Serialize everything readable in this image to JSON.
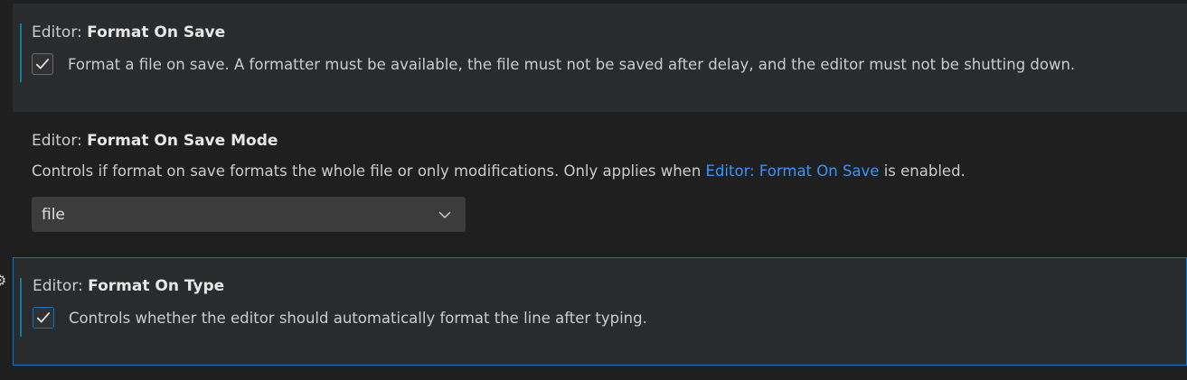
{
  "settings": [
    {
      "category": "Editor: ",
      "name": "Format On Save",
      "description": "Format a file on save. A formatter must be available, the file must not be saved after delay, and the editor must not be shutting down.",
      "checked": true
    },
    {
      "category": "Editor: ",
      "name": "Format On Save Mode",
      "description_before": "Controls if format on save formats the whole file or only modifications. Only applies when ",
      "description_link": "Editor: Format On Save",
      "description_after": " is enabled.",
      "value": "file"
    },
    {
      "category": "Editor: ",
      "name": "Format On Type",
      "description": "Controls whether the editor should automatically format the line after typing.",
      "checked": true
    }
  ],
  "colors": {
    "accent": "#0078d4",
    "link": "#3794ff",
    "modified_indicator": "#0c7d9d"
  },
  "icons": {
    "check": "check-icon",
    "dropdown": "chevron-down-icon",
    "settings_gear": "gear-icon"
  }
}
